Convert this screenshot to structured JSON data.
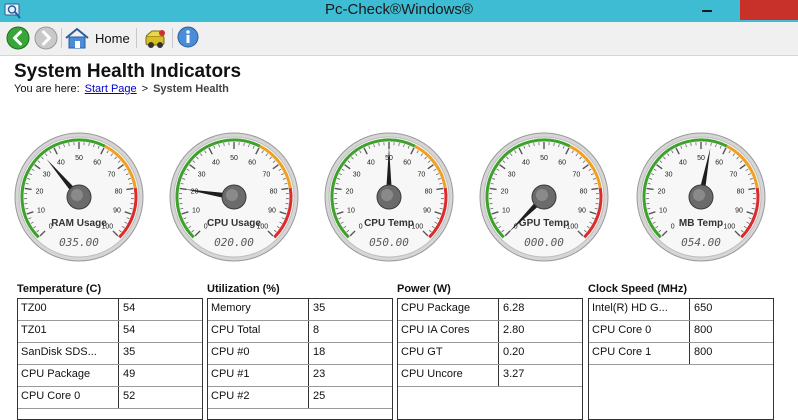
{
  "window": {
    "title": "Pc-Check®Windows®"
  },
  "toolbar": {
    "home_label": "Home"
  },
  "page": {
    "title": "System Health Indicators",
    "breadcrumb_prefix": "You are here:",
    "breadcrumb_link": "Start Page",
    "breadcrumb_separator": ">",
    "breadcrumb_current": "System Health"
  },
  "colors": {
    "titlebar": "#3dbcd3",
    "close": "#c7312a",
    "gauge_green": "#3da12c",
    "gauge_orange": "#f0a020",
    "gauge_red": "#dd2a2a"
  },
  "gauge_scale": {
    "min": 0,
    "max": 100,
    "ticks": [
      "0",
      "10",
      "20",
      "30",
      "40",
      "50",
      "60",
      "70",
      "80",
      "90",
      "100"
    ]
  },
  "gauges": [
    {
      "label": "RAM Usage",
      "value": 35,
      "readout": "035.00"
    },
    {
      "label": "CPU Usage",
      "value": 20,
      "readout": "020.00"
    },
    {
      "label": "CPU Temp",
      "value": 50,
      "readout": "050.00"
    },
    {
      "label": "GPU Temp",
      "value": 0,
      "readout": "000.00"
    },
    {
      "label": "MB Temp",
      "value": 54,
      "readout": "054.00"
    }
  ],
  "sections": [
    {
      "title": "Temperature  (C)",
      "rows": [
        {
          "name": "TZ00",
          "value": "54"
        },
        {
          "name": "TZ01",
          "value": "54"
        },
        {
          "name": "SanDisk SDS...",
          "value": "35"
        },
        {
          "name": "CPU Package",
          "value": "49"
        },
        {
          "name": "CPU Core 0",
          "value": "52"
        }
      ]
    },
    {
      "title": "Utilization (%)",
      "rows": [
        {
          "name": "Memory",
          "value": "35"
        },
        {
          "name": "CPU Total",
          "value": "8"
        },
        {
          "name": "CPU #0",
          "value": "18"
        },
        {
          "name": "CPU #1",
          "value": "23"
        },
        {
          "name": "CPU #2",
          "value": "25"
        }
      ]
    },
    {
      "title": "Power (W)",
      "rows": [
        {
          "name": "CPU Package",
          "value": "6.28"
        },
        {
          "name": "CPU IA Cores",
          "value": "2.80"
        },
        {
          "name": "CPU GT",
          "value": "0.20"
        },
        {
          "name": "CPU Uncore",
          "value": "3.27"
        }
      ]
    },
    {
      "title": "Clock Speed (MHz)",
      "rows": [
        {
          "name": "Intel(R) HD G...",
          "value": "650"
        },
        {
          "name": "CPU Core 0",
          "value": "800"
        },
        {
          "name": "CPU Core 1",
          "value": "800"
        }
      ]
    }
  ]
}
